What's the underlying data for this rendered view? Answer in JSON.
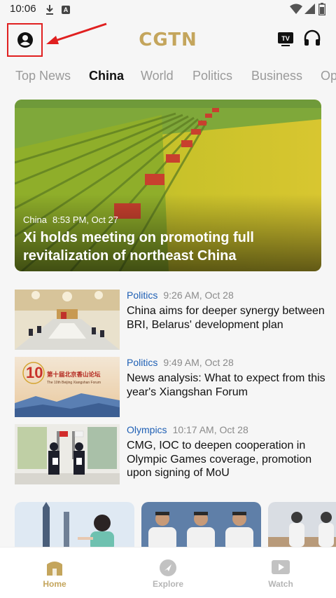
{
  "status_bar": {
    "time": "10:06"
  },
  "header": {
    "logo": "CGTN",
    "tv_label": "TV"
  },
  "tabs": [
    "Top News",
    "China",
    "World",
    "Politics",
    "Business",
    "Op"
  ],
  "active_tab": "China",
  "hero": {
    "category": "China",
    "time": "8:53 PM, Oct 27",
    "title": "Xi holds meeting on promoting full revitalization of northeast China"
  },
  "news": [
    {
      "category": "Politics",
      "time": "9:26 AM, Oct 28",
      "title": "China aims for deeper synergy between BRI, Belarus' development plan"
    },
    {
      "category": "Politics",
      "time": "9:49 AM, Oct 28",
      "title": "News analysis: What to expect from this year's Xiangshan Forum",
      "thumb_text": "第十届北京香山论坛",
      "thumb_subtext": "The 10th Beijing Xiangshan Forum"
    },
    {
      "category": "Olympics",
      "time": "10:17 AM, Oct 28",
      "title": "CMG, IOC to deepen cooperation in Olympic Games coverage, promotion upon signing of MoU"
    }
  ],
  "bottom_nav": [
    {
      "label": "Home",
      "icon": "home-icon"
    },
    {
      "label": "Explore",
      "icon": "explore-icon"
    },
    {
      "label": "Watch",
      "icon": "watch-icon"
    }
  ],
  "colors": {
    "brand_gold": "#c4a55c",
    "category_blue": "#1e5fb4",
    "annotation_red": "#e02020"
  }
}
